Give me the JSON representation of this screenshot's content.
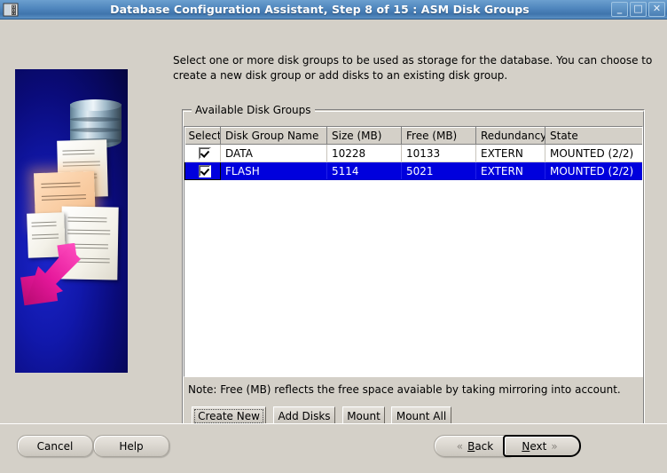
{
  "window": {
    "title": "Database Configuration Assistant, Step 8 of 15 : ASM Disk Groups",
    "icon": "app-icon",
    "controls": {
      "minimize": "_",
      "maximize": "□",
      "close": "✕"
    }
  },
  "instructions": "Select one or more disk groups to be used as storage for the database. You can choose to create a new disk group or add disks to an existing disk group.",
  "group": {
    "title": "Available Disk Groups"
  },
  "table": {
    "columns": [
      "Select",
      "Disk Group Name",
      "Size (MB)",
      "Free (MB)",
      "Redundancy",
      "State"
    ],
    "rows": [
      {
        "selected": true,
        "checked": true,
        "name": "DATA",
        "size": "10228",
        "free": "10133",
        "redundancy": "EXTERN",
        "state": "MOUNTED (2/2)",
        "highlighted": false
      },
      {
        "selected": true,
        "checked": true,
        "name": "FLASH",
        "size": "5114",
        "free": "5021",
        "redundancy": "EXTERN",
        "state": "MOUNTED (2/2)",
        "highlighted": true
      }
    ]
  },
  "note": "Note: Free (MB) reflects the free space avaiable by taking mirroring into account.",
  "actions": {
    "create_new": "Create New",
    "add_disks": "Add Disks",
    "mount": "Mount",
    "mount_all": "Mount All"
  },
  "footer": {
    "cancel": "Cancel",
    "help": "Help",
    "back": "Back",
    "next": "Next",
    "back_chevron": "«",
    "next_chevron": "»"
  },
  "colors": {
    "titlebar_blue": "#4f86bd",
    "selection_blue": "#0000dd",
    "panel_gray": "#d4d0c8",
    "art_blue": "#1118ab",
    "arrow_magenta": "#e6189b"
  }
}
